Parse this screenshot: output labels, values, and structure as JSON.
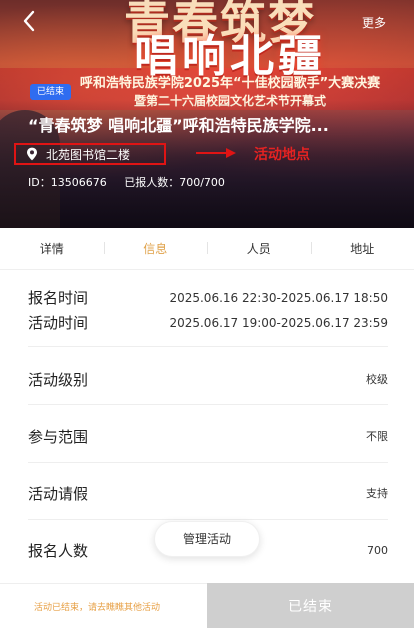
{
  "header": {
    "back_glyph": "<",
    "more_label": "更多",
    "poster_line_1": "青春筑梦",
    "poster_line_2": "唱响北疆",
    "poster_sub_1": "呼和浩特民族学院2025年“十佳校园歌手”大赛决赛",
    "poster_sub_2": "暨第二十六届校园文化艺术节开幕式"
  },
  "event": {
    "status": "已结束",
    "title": "“青春筑梦 唱响北疆”呼和浩特民族学院...",
    "location": "北苑图书馆二楼",
    "annotation": "活动地点",
    "id_text": "ID：13506676",
    "enrolled_text": "已报人数：700/700"
  },
  "tabs": [
    {
      "label": "详情",
      "active": false
    },
    {
      "label": "信息",
      "active": true
    },
    {
      "label": "人员",
      "active": false
    },
    {
      "label": "地址",
      "active": false
    }
  ],
  "info": {
    "signup_time_label": "报名时间",
    "signup_time_value": "2025.06.16 22:30-2025.06.17 18:50",
    "activity_time_label": "活动时间",
    "activity_time_value": "2025.06.17 19:00-2025.06.17 23:59",
    "level_label": "活动级别",
    "level_value": "校级",
    "scope_label": "参与范围",
    "scope_value": "不限",
    "leave_label": "活动请假",
    "leave_value": "支持",
    "count_label": "报名人数",
    "count_value": "700"
  },
  "manage_button": "管理活动",
  "footer": {
    "note": "活动已结束，请去瞧瞧其他活动",
    "ended_label": "已结束"
  },
  "colors": {
    "accent_orange": "#e0a24a",
    "status_blue": "#2f6cf0",
    "annotation_red": "#e01414",
    "disabled_gray": "#cfcfcf"
  }
}
